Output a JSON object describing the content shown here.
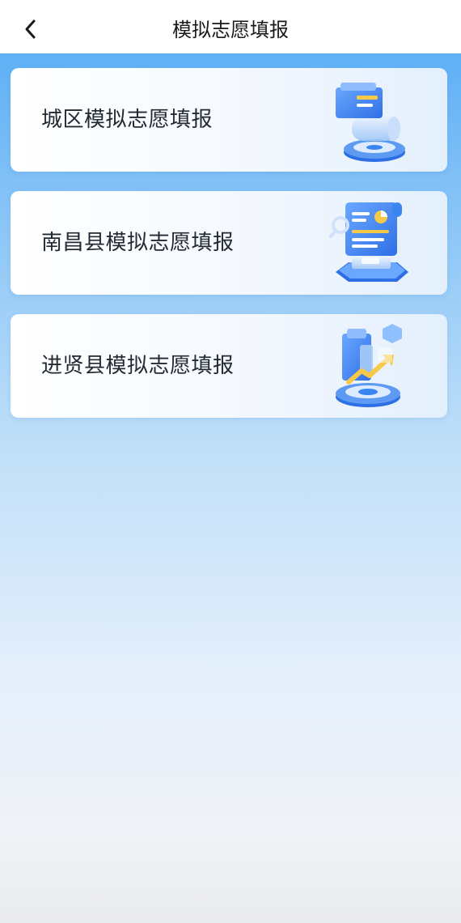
{
  "header": {
    "title": "模拟志愿填报",
    "back_icon": "chevron-left-icon"
  },
  "options": [
    {
      "label": "城区模拟志愿填报",
      "icon": "document-stack-icon"
    },
    {
      "label": "南昌县模拟志愿填报",
      "icon": "report-scroll-icon"
    },
    {
      "label": "进贤县模拟志愿填报",
      "icon": "growth-chart-icon"
    }
  ],
  "colors": {
    "accent": "#3a86f0",
    "highlight": "#f7c948",
    "gradient_top": "#5fb0f6",
    "gradient_bottom": "#e9eaec"
  }
}
